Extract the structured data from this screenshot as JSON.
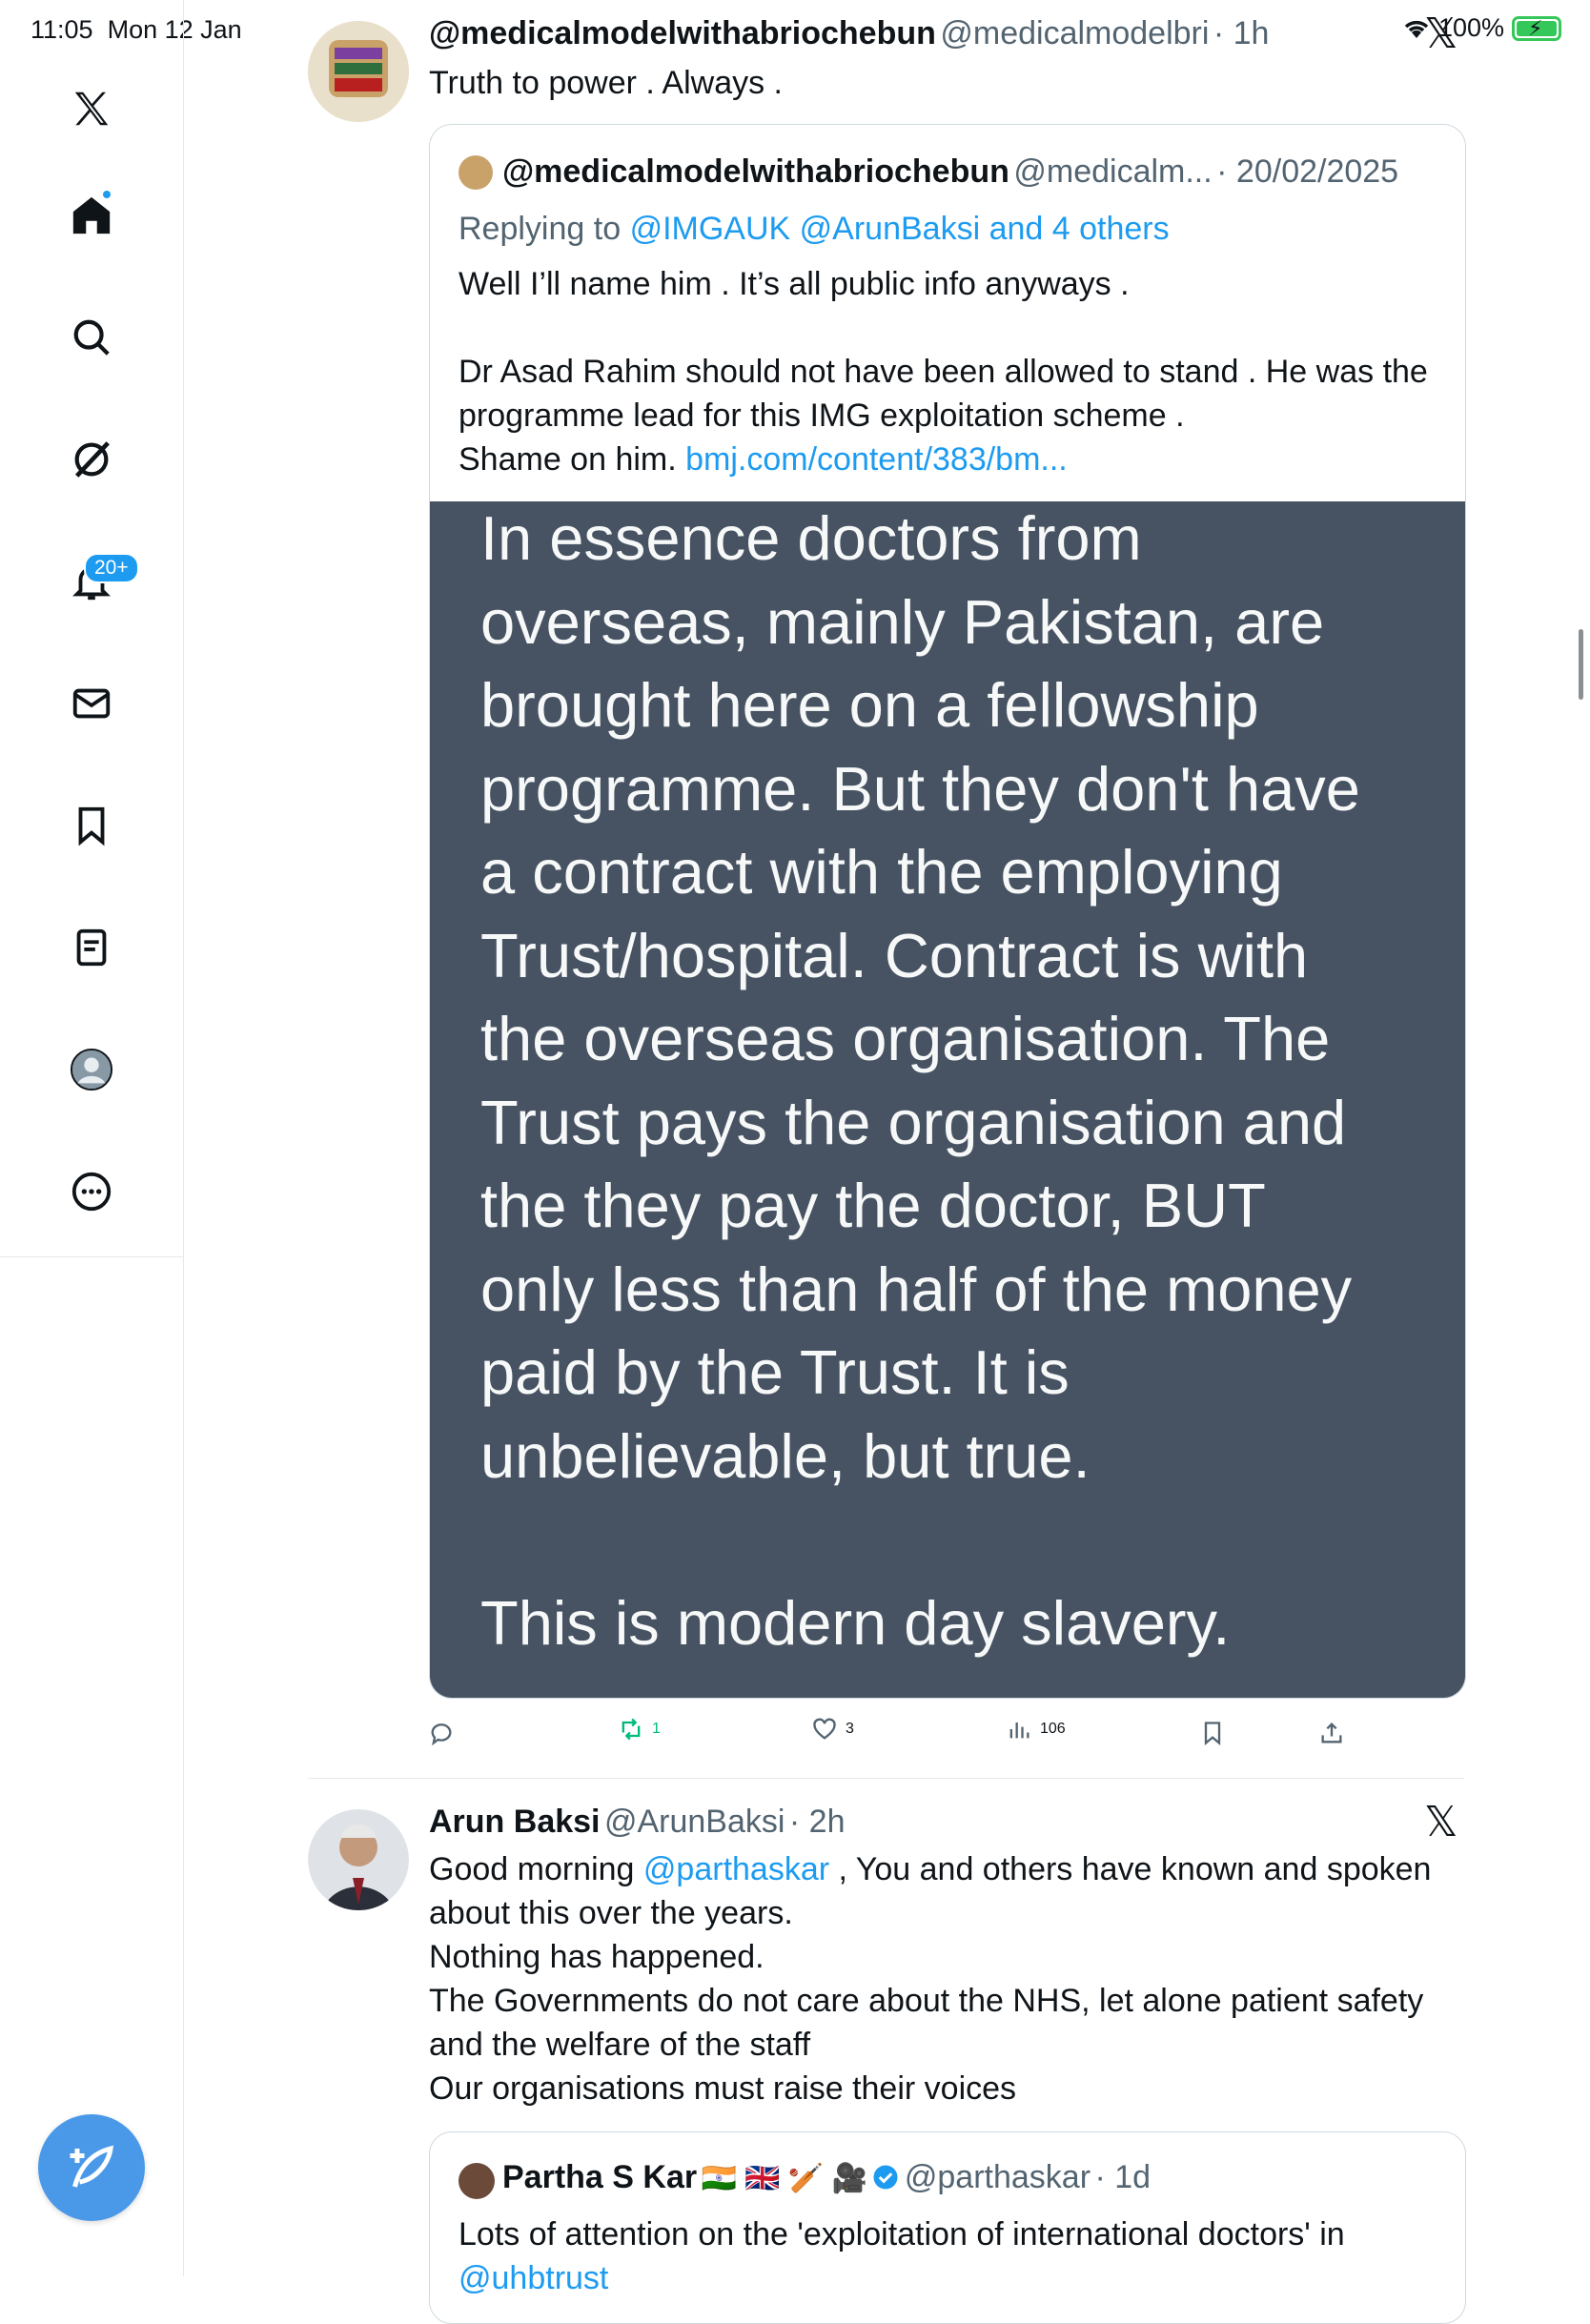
{
  "status_bar": {
    "time": "11:05",
    "date": "Mon 12 Jan",
    "battery": "100%"
  },
  "sidebar": {
    "items": [
      {
        "name": "home",
        "icon": "home-icon"
      },
      {
        "name": "explore",
        "icon": "search-icon"
      },
      {
        "name": "grok",
        "icon": "grok-icon"
      },
      {
        "name": "notifications",
        "icon": "bell-icon",
        "badge": "20+"
      },
      {
        "name": "messages",
        "icon": "mail-icon"
      },
      {
        "name": "bookmarks",
        "icon": "bookmark-icon"
      },
      {
        "name": "lists",
        "icon": "list-icon"
      },
      {
        "name": "profile",
        "icon": "avatar-icon"
      },
      {
        "name": "more",
        "icon": "more-icon"
      }
    ],
    "compose": "compose-icon"
  },
  "tweet1": {
    "display_name": "@medicalmodelwithabriochebun",
    "handle": "@medicalmodelbri",
    "time": "· 1h",
    "text": "Truth to power . Always .",
    "quote": {
      "display_name": "@medicalmodelwithabriochebun",
      "handle": "@medicalm...",
      "date": "· 20/02/2025",
      "replying_prefix": "Replying to",
      "replying_to": "@IMGAUK @ArunBaksi and 4 others",
      "line1": "Well I’ll name him . It’s all public info anyways .",
      "line2": "Dr Asad Rahim should not have been allowed to stand . He was the",
      "line3": "programme lead for this IMG exploitation scheme .",
      "line4": "Shame on him.",
      "link": "bmj.com/content/383/bm...",
      "image_lines": [
        "In essence doctors from",
        "overseas, mainly Pakistan, are",
        "brought here on a fellowship",
        "programme. But they don't have",
        "a contract with the employing",
        "Trust/hospital. Contract is with",
        "the overseas organisation. The",
        "Trust pays the organisation and",
        "the they pay the doctor, BUT",
        "only less than half of the money",
        "paid by the Trust. It is",
        "unbelievable, but true.",
        "",
        "This is modern day slavery."
      ]
    },
    "actions": {
      "reposts": "1",
      "likes": "3",
      "views": "106"
    }
  },
  "tweet2": {
    "display_name": "Arun Baksi",
    "handle": "@ArunBaksi",
    "time": "· 2h",
    "text_prefix": "Good morning",
    "mention": "@parthaskar",
    "text_suffix": " , You and others have known and spoken",
    "line2": "about this over the years.",
    "line3": "Nothing has happened.",
    "line4": "The Governments do not care about the NHS, let alone patient safety",
    "line5": "and the welfare of the staff",
    "line6": "Our organisations must raise their voices",
    "quote": {
      "display_name": "Partha S Kar",
      "flags": "🇮🇳 🇬🇧 🏏 🎥",
      "handle": "@parthaskar",
      "time": "· 1d",
      "text": "Lots of attention on the 'exploitation of international doctors' in",
      "text2": "@uhbtrust"
    }
  },
  "colors": {
    "accent": "#1d9bf0",
    "repost": "#00ba7c",
    "image_bg": "#475363"
  }
}
